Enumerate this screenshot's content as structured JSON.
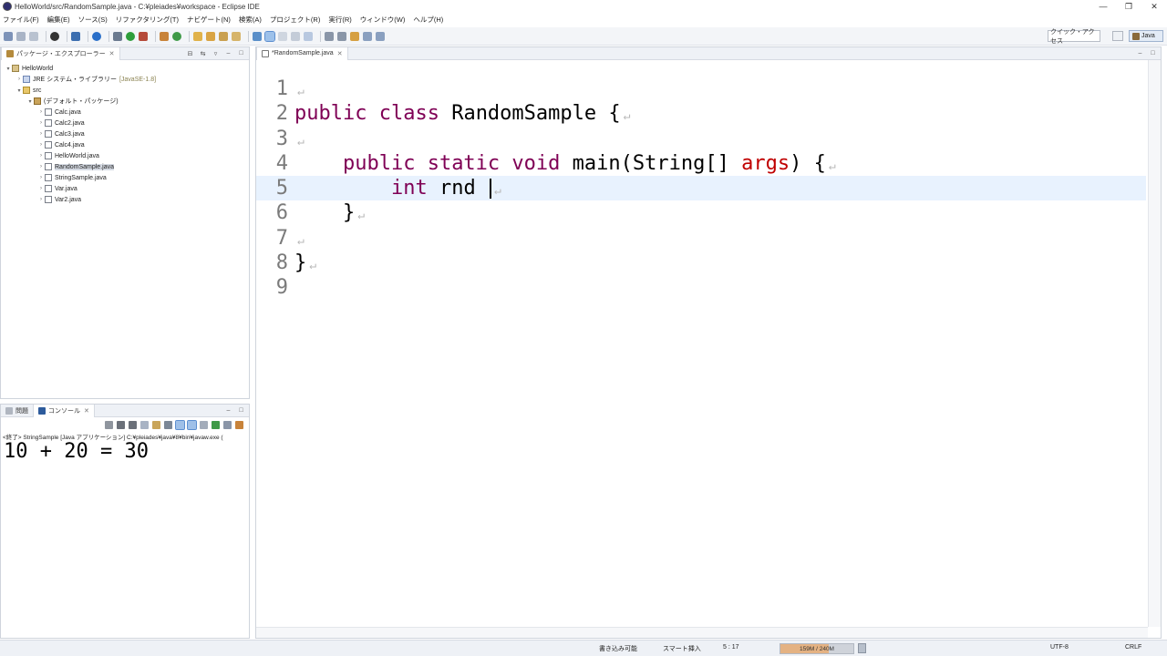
{
  "window": {
    "title": "HelloWorld/src/RandomSample.java - C:¥pleiades¥workspace - Eclipse IDE",
    "controls": [
      "—",
      "❐",
      "✕"
    ]
  },
  "menu": [
    "ファイル(F)",
    "編集(E)",
    "ソース(S)",
    "リファクタリング(T)",
    "ナビゲート(N)",
    "検索(A)",
    "プロジェクト(R)",
    "実行(R)",
    "ウィンドウ(W)",
    "ヘルプ(H)"
  ],
  "toolbar": {
    "quick_access": "クイック・アクセス",
    "perspective": "Java"
  },
  "explorer": {
    "tab": "パッケージ・エクスプローラー",
    "tab_close": "✕",
    "tree": [
      {
        "label": "HelloWorld",
        "twisty": "▾",
        "icon": "project"
      },
      {
        "label": "JRE システム・ライブラリー",
        "decoration": "[JavaSE-1.8]",
        "twisty": "›",
        "icon": "lib"
      },
      {
        "label": "src",
        "twisty": "▾",
        "icon": "folder"
      },
      {
        "label": "(デフォルト・パッケージ)",
        "twisty": "▾",
        "icon": "pkg"
      },
      {
        "label": "Calc.java",
        "twisty": "›",
        "icon": "java"
      },
      {
        "label": "Calc2.java",
        "twisty": "›",
        "icon": "java"
      },
      {
        "label": "Calc3.java",
        "twisty": "›",
        "icon": "java"
      },
      {
        "label": "Calc4.java",
        "twisty": "›",
        "icon": "java"
      },
      {
        "label": "HelloWorld.java",
        "twisty": "›",
        "icon": "java"
      },
      {
        "label": "RandomSample.java",
        "twisty": "›",
        "icon": "java",
        "selected": true
      },
      {
        "label": "StringSample.java",
        "twisty": "›",
        "icon": "java"
      },
      {
        "label": "Var.java",
        "twisty": "›",
        "icon": "java"
      },
      {
        "label": "Var2.java",
        "twisty": "›",
        "icon": "java"
      }
    ]
  },
  "bottom_panel": {
    "tab_problems": "問題",
    "tab_console": "コンソール",
    "tab_close": "✕",
    "header": "<終了> StringSample [Java アプリケーション] C:¥pleiades¥java¥8¥bin¥javaw.exe (",
    "output": "10 + 20 = 30"
  },
  "editor": {
    "tab": "*RandomSample.java",
    "tab_close": "✕",
    "current_line": 5,
    "lines": [
      {
        "num": "1",
        "tokens": []
      },
      {
        "num": "2",
        "tokens": [
          {
            "t": "public class",
            "k": "kw"
          },
          {
            "t": " RandomSample {"
          }
        ]
      },
      {
        "num": "3",
        "tokens": []
      },
      {
        "num": "4",
        "tokens": [
          {
            "t": "    "
          },
          {
            "t": "public static void",
            "k": "kw"
          },
          {
            "t": " main(String[] "
          },
          {
            "t": "args",
            "k": "param"
          },
          {
            "t": ") {"
          }
        ]
      },
      {
        "num": "5",
        "tokens": [
          {
            "t": "        "
          },
          {
            "t": "int",
            "k": "kw"
          },
          {
            "t": " rnd "
          }
        ],
        "caret": true
      },
      {
        "num": "6",
        "tokens": [
          {
            "t": "    }"
          }
        ]
      },
      {
        "num": "7",
        "tokens": []
      },
      {
        "num": "8",
        "tokens": [
          {
            "t": "}"
          }
        ]
      },
      {
        "num": "9",
        "tokens": [],
        "no_return": true
      }
    ]
  },
  "status": {
    "writable": "書き込み可能",
    "insert_mode": "スマート挿入",
    "position": "5 : 17",
    "heap": "159M / 240M",
    "heap_fraction": 0.66,
    "encoding": "UTF-8",
    "line_delimiter": "CRLF"
  }
}
